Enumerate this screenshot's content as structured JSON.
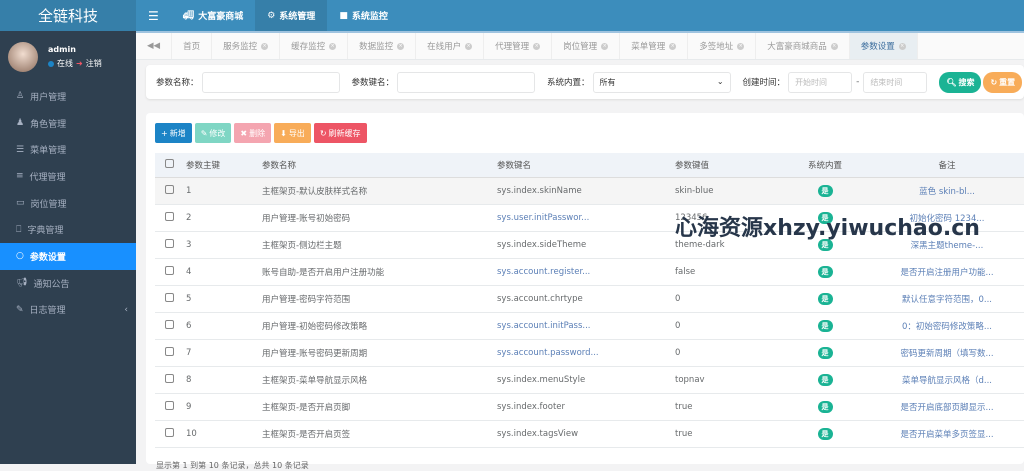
{
  "app": {
    "logo": "全链科技"
  },
  "topnav": [
    {
      "label": "大富豪商城",
      "icon": "truck-icon"
    },
    {
      "label": "系统管理",
      "icon": "gear-icon",
      "active": true
    },
    {
      "label": "系统监控",
      "icon": "video-icon"
    }
  ],
  "user": {
    "name": "admin",
    "status": "在线",
    "logout": "注销"
  },
  "sidebar": [
    {
      "label": "用户管理",
      "icon": "user-icon"
    },
    {
      "label": "角色管理",
      "icon": "role-icon"
    },
    {
      "label": "菜单管理",
      "icon": "list-icon"
    },
    {
      "label": "代理管理",
      "icon": "list-alt-icon"
    },
    {
      "label": "岗位管理",
      "icon": "id-card-icon"
    },
    {
      "label": "字典管理",
      "icon": "bookmark-icon"
    },
    {
      "label": "参数设置",
      "icon": "circle-icon",
      "active": true
    },
    {
      "label": "通知公告",
      "icon": "bullhorn-icon"
    },
    {
      "label": "日志管理",
      "icon": "edit-icon"
    }
  ],
  "tabs": [
    "首页",
    "服务监控",
    "缓存监控",
    "数据监控",
    "在线用户",
    "代理管理",
    "岗位管理",
    "菜单管理",
    "多签地址",
    "大富豪商城商品",
    "参数设置"
  ],
  "search": {
    "name_label": "参数名称：",
    "key_label": "参数键名：",
    "type_label": "系统内置：",
    "type_value": "所有",
    "time_label": "创建时间：",
    "start_ph": "开始时间",
    "sep": "-",
    "end_ph": "结束时间",
    "search_btn": "搜索",
    "reset_btn": "重置"
  },
  "toolbar": {
    "add": "新增",
    "edit": "修改",
    "delete": "删除",
    "export": "导出",
    "refresh": "刷新缓存"
  },
  "table": {
    "headers": [
      "参数主键",
      "参数名称",
      "参数键名",
      "参数键值",
      "系统内置",
      "备注"
    ],
    "rows": [
      [
        "1",
        "主框架页-默认皮肤样式名称",
        "sys.index.skinName",
        "skin-blue",
        "是",
        "蓝色 skin-bl..."
      ],
      [
        "2",
        "用户管理-账号初始密码",
        "sys.user.initPasswor...",
        "123456",
        "是",
        "初始化密码 1234..."
      ],
      [
        "3",
        "主框架页-侧边栏主题",
        "sys.index.sideTheme",
        "theme-dark",
        "是",
        "深黑主题theme-..."
      ],
      [
        "4",
        "账号自助-是否开启用户注册功能",
        "sys.account.register...",
        "false",
        "是",
        "是否开启注册用户功能..."
      ],
      [
        "5",
        "用户管理-密码字符范围",
        "sys.account.chrtype",
        "0",
        "是",
        "默认任意字符范围，0..."
      ],
      [
        "6",
        "用户管理-初始密码修改策略",
        "sys.account.initPass...",
        "0",
        "是",
        "0：初始密码修改策略..."
      ],
      [
        "7",
        "用户管理-账号密码更新周期",
        "sys.account.password...",
        "0",
        "是",
        "密码更新周期（填写数..."
      ],
      [
        "8",
        "主框架页-菜单导航显示风格",
        "sys.index.menuStyle",
        "topnav",
        "是",
        "菜单导航显示风格（d..."
      ],
      [
        "9",
        "主框架页-是否开启页脚",
        "sys.index.footer",
        "true",
        "是",
        "是否开启底部页脚显示..."
      ],
      [
        "10",
        "主框架页-是否开启页签",
        "sys.index.tagsView",
        "true",
        "是",
        "是否开启菜单多页签显..."
      ]
    ]
  },
  "footer": "显示第 1 到第 10 条记录，总共 10 条记录",
  "watermark": "心海资源xhzy.yiwuchao.cn",
  "colors": {
    "topbar": "#3c8dbc",
    "sidebar": "#2f4050",
    "active": "#1890ff",
    "green": "#1ab394"
  }
}
